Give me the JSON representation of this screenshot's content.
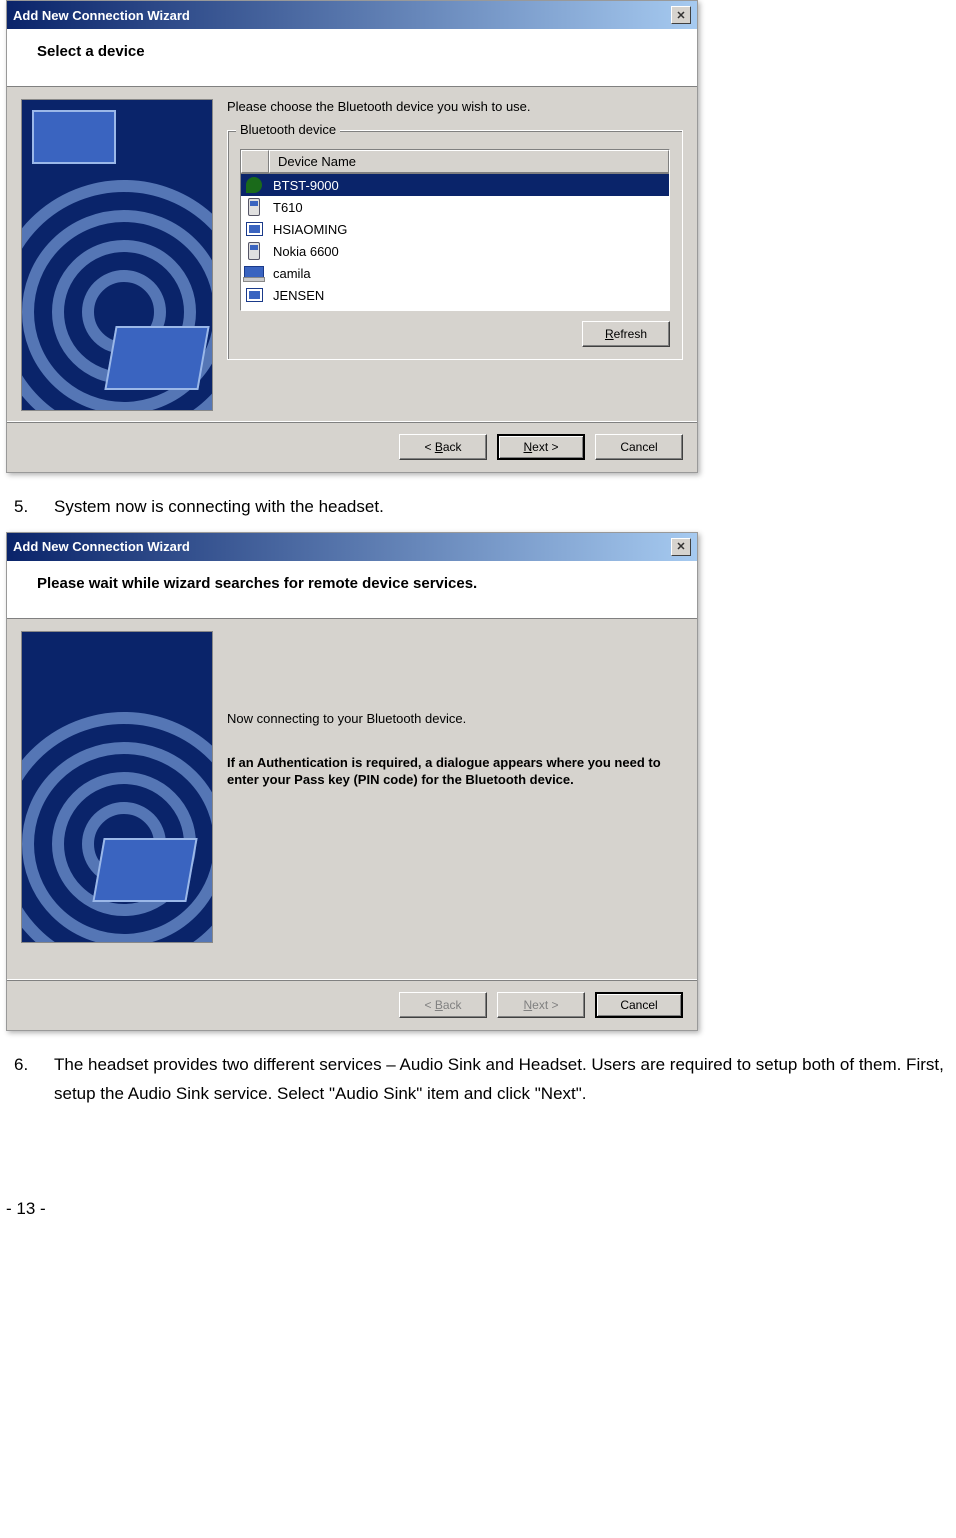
{
  "dialog1": {
    "title": "Add New Connection Wizard",
    "header": "Select a device",
    "instruction": "Please choose the Bluetooth device you wish to use.",
    "groupboxLabel": "Bluetooth device",
    "columnHeader": "Device Name",
    "devices": [
      {
        "name": "BTST-9000",
        "type": "headset",
        "selected": true
      },
      {
        "name": "T610",
        "type": "phone",
        "selected": false
      },
      {
        "name": "HSIAOMING",
        "type": "desktop",
        "selected": false
      },
      {
        "name": "Nokia 6600",
        "type": "phone",
        "selected": false
      },
      {
        "name": "camila",
        "type": "laptop",
        "selected": false
      },
      {
        "name": "JENSEN",
        "type": "desktop",
        "selected": false
      }
    ],
    "refreshBtn": "Refresh",
    "backBtn": "< Back",
    "nextBtn": "Next >",
    "cancelBtn": "Cancel"
  },
  "step5": {
    "num": "5.",
    "text": "System now is connecting with the headset."
  },
  "dialog2": {
    "title": "Add New Connection Wizard",
    "header": "Please wait while wizard searches for remote device services.",
    "msg1": "Now connecting to your Bluetooth device.",
    "msg2": "If an Authentication is required, a dialogue appears where you need to enter your Pass key (PIN code) for the Bluetooth device.",
    "backBtn": "< Back",
    "nextBtn": "Next >",
    "cancelBtn": "Cancel"
  },
  "step6": {
    "num": "6.",
    "text": "The headset provides two different services – Audio Sink and Headset. Users are required to setup both of them. First, setup the Audio Sink service. Select \"Audio Sink\" item and click \"Next\"."
  },
  "pageNumber": "- 13 -"
}
